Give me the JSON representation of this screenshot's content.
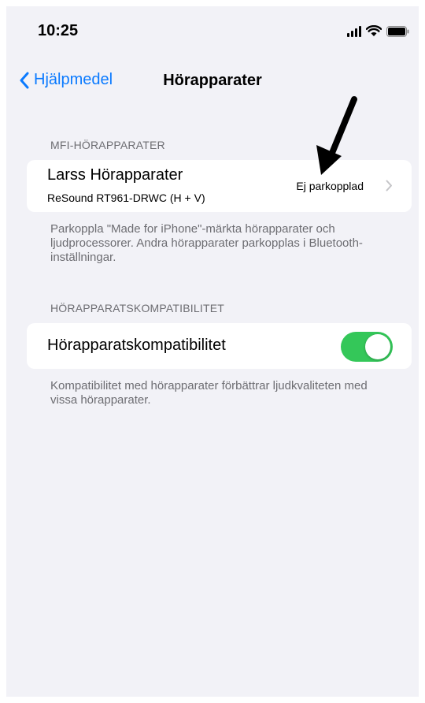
{
  "status_bar": {
    "time": "10:25"
  },
  "nav": {
    "back_label": "Hjälpmedel",
    "title": "Hörapparater"
  },
  "mfi_section": {
    "header": "MFI-HÖRAPPARATER",
    "device": {
      "name": "Larss Hörapparater",
      "model": "ReSound RT961-DRWC (H + V)",
      "status": "Ej parkopplad"
    },
    "footer": "Parkoppla \"Made for iPhone\"-märkta hörapparater och ljudprocessorer. Andra hörapparater parkopplas i Bluetooth-inställningar."
  },
  "compat_section": {
    "header": "HÖRAPPARATSKOMPATIBILITET",
    "toggle_label": "Hörapparatskompatibilitet",
    "toggle_on": true,
    "footer": "Kompatibilitet med hörapparater förbättrar ljudkvaliteten med vissa hörapparater."
  },
  "colors": {
    "accent": "#0a7aff",
    "toggle_on": "#34c759",
    "background": "#f2f2f7"
  },
  "icons": [
    "signal-icon",
    "wifi-icon",
    "battery-icon",
    "chevron-left-icon",
    "chevron-right-icon",
    "arrow-annotation-icon"
  ]
}
